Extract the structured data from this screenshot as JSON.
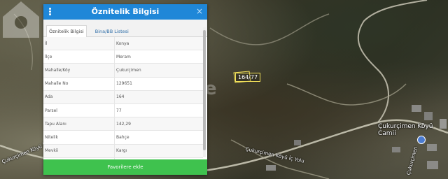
{
  "panel": {
    "title": "Öznitelik Bilgisi",
    "close_label": "×",
    "tabs": [
      {
        "label": "Öznitelik Bilgisi"
      },
      {
        "label": "Bina/BB Listesi"
      }
    ],
    "rows": [
      {
        "key": "İl",
        "value": "Konya"
      },
      {
        "key": "İlçe",
        "value": "Meram"
      },
      {
        "key": "Mahalle/Köy",
        "value": "Çukurçimen"
      },
      {
        "key": "Mahalle No",
        "value": "129651"
      },
      {
        "key": "Ada",
        "value": "164"
      },
      {
        "key": "Parsel",
        "value": "77"
      },
      {
        "key": "Tapu Alanı",
        "value": "142,29"
      },
      {
        "key": "Nitelik",
        "value": "Bahçe"
      },
      {
        "key": "Mevkii",
        "value": "Kargı"
      },
      {
        "key": "Zemin Tip",
        "value": "Ana Taşınmaz"
      },
      {
        "key": "Pafta",
        "value": "N28-A-05-A-2-B"
      }
    ],
    "favorite_button": "Favorilere ekle"
  },
  "map": {
    "parcel_label": "164/77",
    "place_label": "Çukurçimen Köyü Camii",
    "road_label_left": "Çukurçimen Köyü İç Yolu",
    "road_label_bottom": "Çukurçimen Köyü İç Yolu",
    "road_label_right": "Çukurçimen",
    "watermark_text": "e"
  }
}
